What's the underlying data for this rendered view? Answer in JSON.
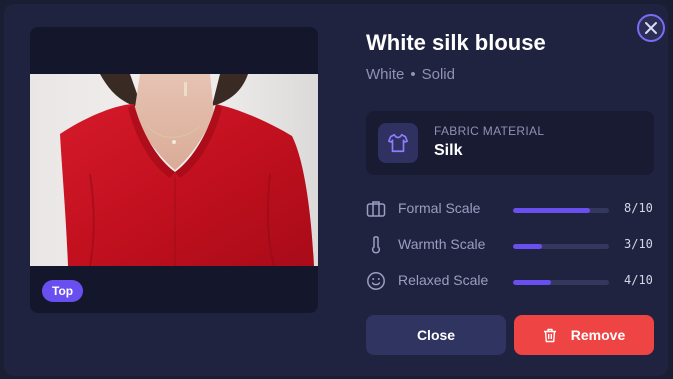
{
  "item": {
    "title": "White silk blouse",
    "color": "White",
    "pattern": "Solid",
    "category_badge": "Top"
  },
  "fabric": {
    "kicker": "FABRIC MATERIAL",
    "value": "Silk",
    "icon": "shirt-icon"
  },
  "scales": [
    {
      "label": "Formal Scale",
      "value_text": "8/10",
      "level": 0.8,
      "icon": "briefcase-icon"
    },
    {
      "label": "Warmth Scale",
      "value_text": "3/10",
      "level": 0.3,
      "icon": "thermometer-icon"
    },
    {
      "label": "Relaxed Scale",
      "value_text": "4/10",
      "level": 0.4,
      "icon": "smile-icon"
    }
  ],
  "actions": {
    "close_label": "Close",
    "remove_label": "Remove"
  },
  "colors": {
    "accent": "#6a4ff0",
    "danger": "#ef4444",
    "modal_bg": "#20233f"
  }
}
